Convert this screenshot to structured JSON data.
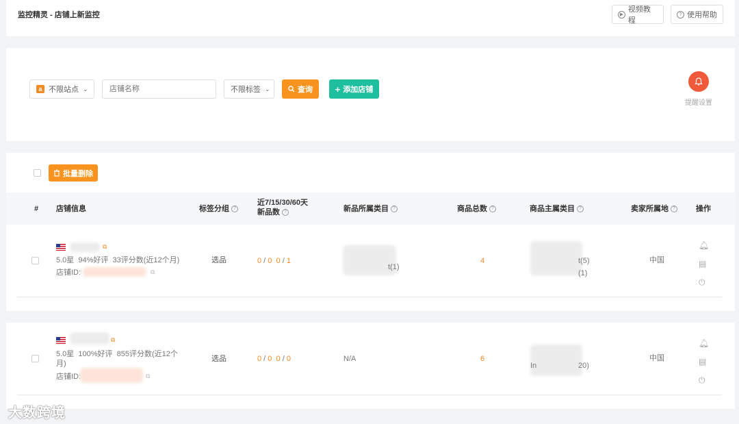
{
  "header": {
    "title": "监控精灵 - 店铺上新监控",
    "video_btn": "视频教程",
    "help_btn": "使用帮助"
  },
  "filters": {
    "site_select": "不限站点",
    "store_placeholder": "店铺名称",
    "tag_select": "不限标签",
    "query_btn": "查询",
    "add_btn": "添加店铺",
    "alert_settings": "提醒设置"
  },
  "toolbar": {
    "batch_delete": "批量删除"
  },
  "columns": {
    "index": "#",
    "store_info": "店铺信息",
    "tag_group": "标签分组",
    "new_count_line1": "近7/15/30/60天",
    "new_count_line2": "新品数",
    "new_category": "新品所属类目",
    "total_products": "商品总数",
    "main_category": "商品主属类目",
    "seller_location": "卖家所属地",
    "actions": "操作"
  },
  "rows": [
    {
      "rating": "5.0星  94%好评  33评分数(近12个月)",
      "store_id_label": "店铺ID:",
      "tag": "选品",
      "c7": "0",
      "c15": "0",
      "c30": "0",
      "c60": "1",
      "new_category": "t(1)",
      "total": "4",
      "main_cat_a": "t(5)",
      "main_cat_b": "(1)",
      "location": "中国"
    },
    {
      "rating_line1": "5.0星  100%好评  855评分数(近12个",
      "rating_line2": "月)",
      "store_id_label": "店铺ID:",
      "tag": "选品",
      "c7": "0",
      "c15": "0",
      "c30": "0",
      "c60": "0",
      "new_category": "N/A",
      "total": "6",
      "main_cat_a": "In",
      "main_cat_b": "20)",
      "location": "中国"
    }
  ],
  "watermark": "大数跨境",
  "colors": {
    "orange": "#f7931e",
    "green": "#1dbf9f",
    "alert": "#f05a3a"
  }
}
